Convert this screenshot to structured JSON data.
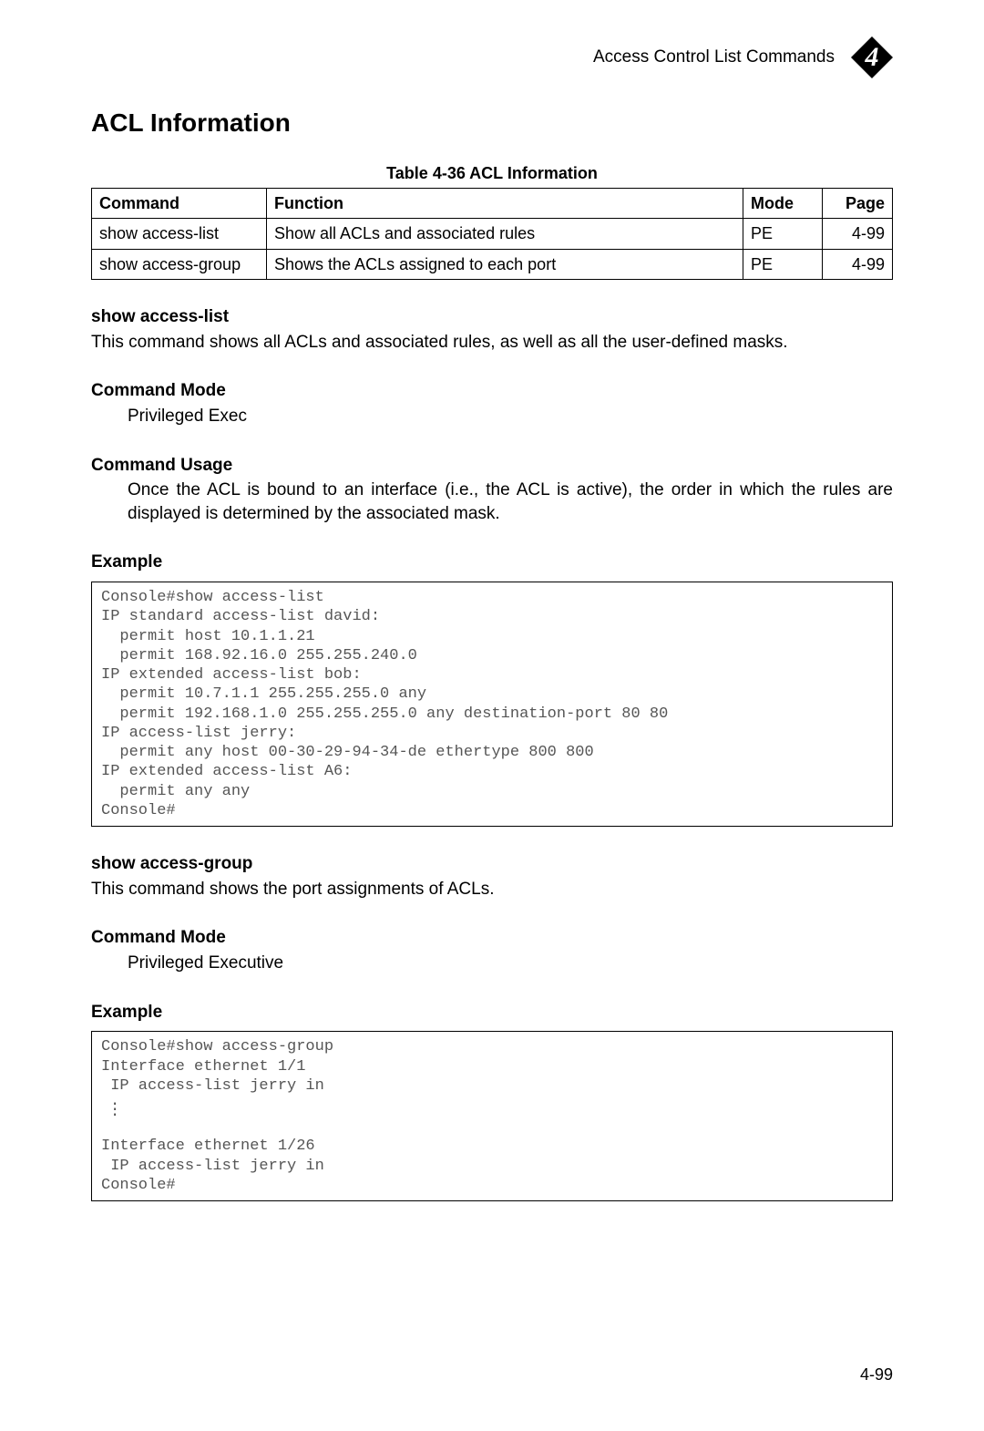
{
  "header": {
    "title": "Access Control List Commands",
    "chapter_number": "4"
  },
  "section_title": "ACL Information",
  "table": {
    "caption": "Table 4-36  ACL Information",
    "headers": {
      "command": "Command",
      "function": "Function",
      "mode": "Mode",
      "page": "Page"
    },
    "rows": [
      {
        "command": "show access-list",
        "function": "Show all ACLs and associated rules",
        "mode": "PE",
        "page": "4-99"
      },
      {
        "command": "show access-group",
        "function": "Shows the ACLs assigned to each port",
        "mode": "PE",
        "page": "4-99"
      }
    ]
  },
  "sections": {
    "show_access_list": {
      "heading": "show access-list",
      "description": "This command shows all ACLs and associated rules, as well as all the user-defined masks.",
      "command_mode_label": "Command Mode",
      "command_mode_value": "Privileged Exec",
      "command_usage_label": "Command Usage",
      "command_usage_text": "Once the ACL is bound to an interface (i.e., the ACL is active), the order in which the rules are displayed is determined by the associated mask.",
      "example_label": "Example",
      "example_code": "Console#show access-list\nIP standard access-list david:\n  permit host 10.1.1.21\n  permit 168.92.16.0 255.255.240.0\nIP extended access-list bob:\n  permit 10.7.1.1 255.255.255.0 any\n  permit 192.168.1.0 255.255.255.0 any destination-port 80 80\nIP access-list jerry:\n  permit any host 00-30-29-94-34-de ethertype 800 800\nIP extended access-list A6:\n  permit any any\nConsole#"
    },
    "show_access_group": {
      "heading": "show access-group",
      "description": "This command shows the port assignments of ACLs.",
      "command_mode_label": "Command Mode",
      "command_mode_value": "Privileged Executive",
      "example_label": "Example",
      "example_code_top": "Console#show access-group\nInterface ethernet 1/1\n IP access-list jerry in",
      "example_code_bottom": "Interface ethernet 1/26\n IP access-list jerry in\nConsole#"
    }
  },
  "footer": {
    "page": "4-99"
  }
}
